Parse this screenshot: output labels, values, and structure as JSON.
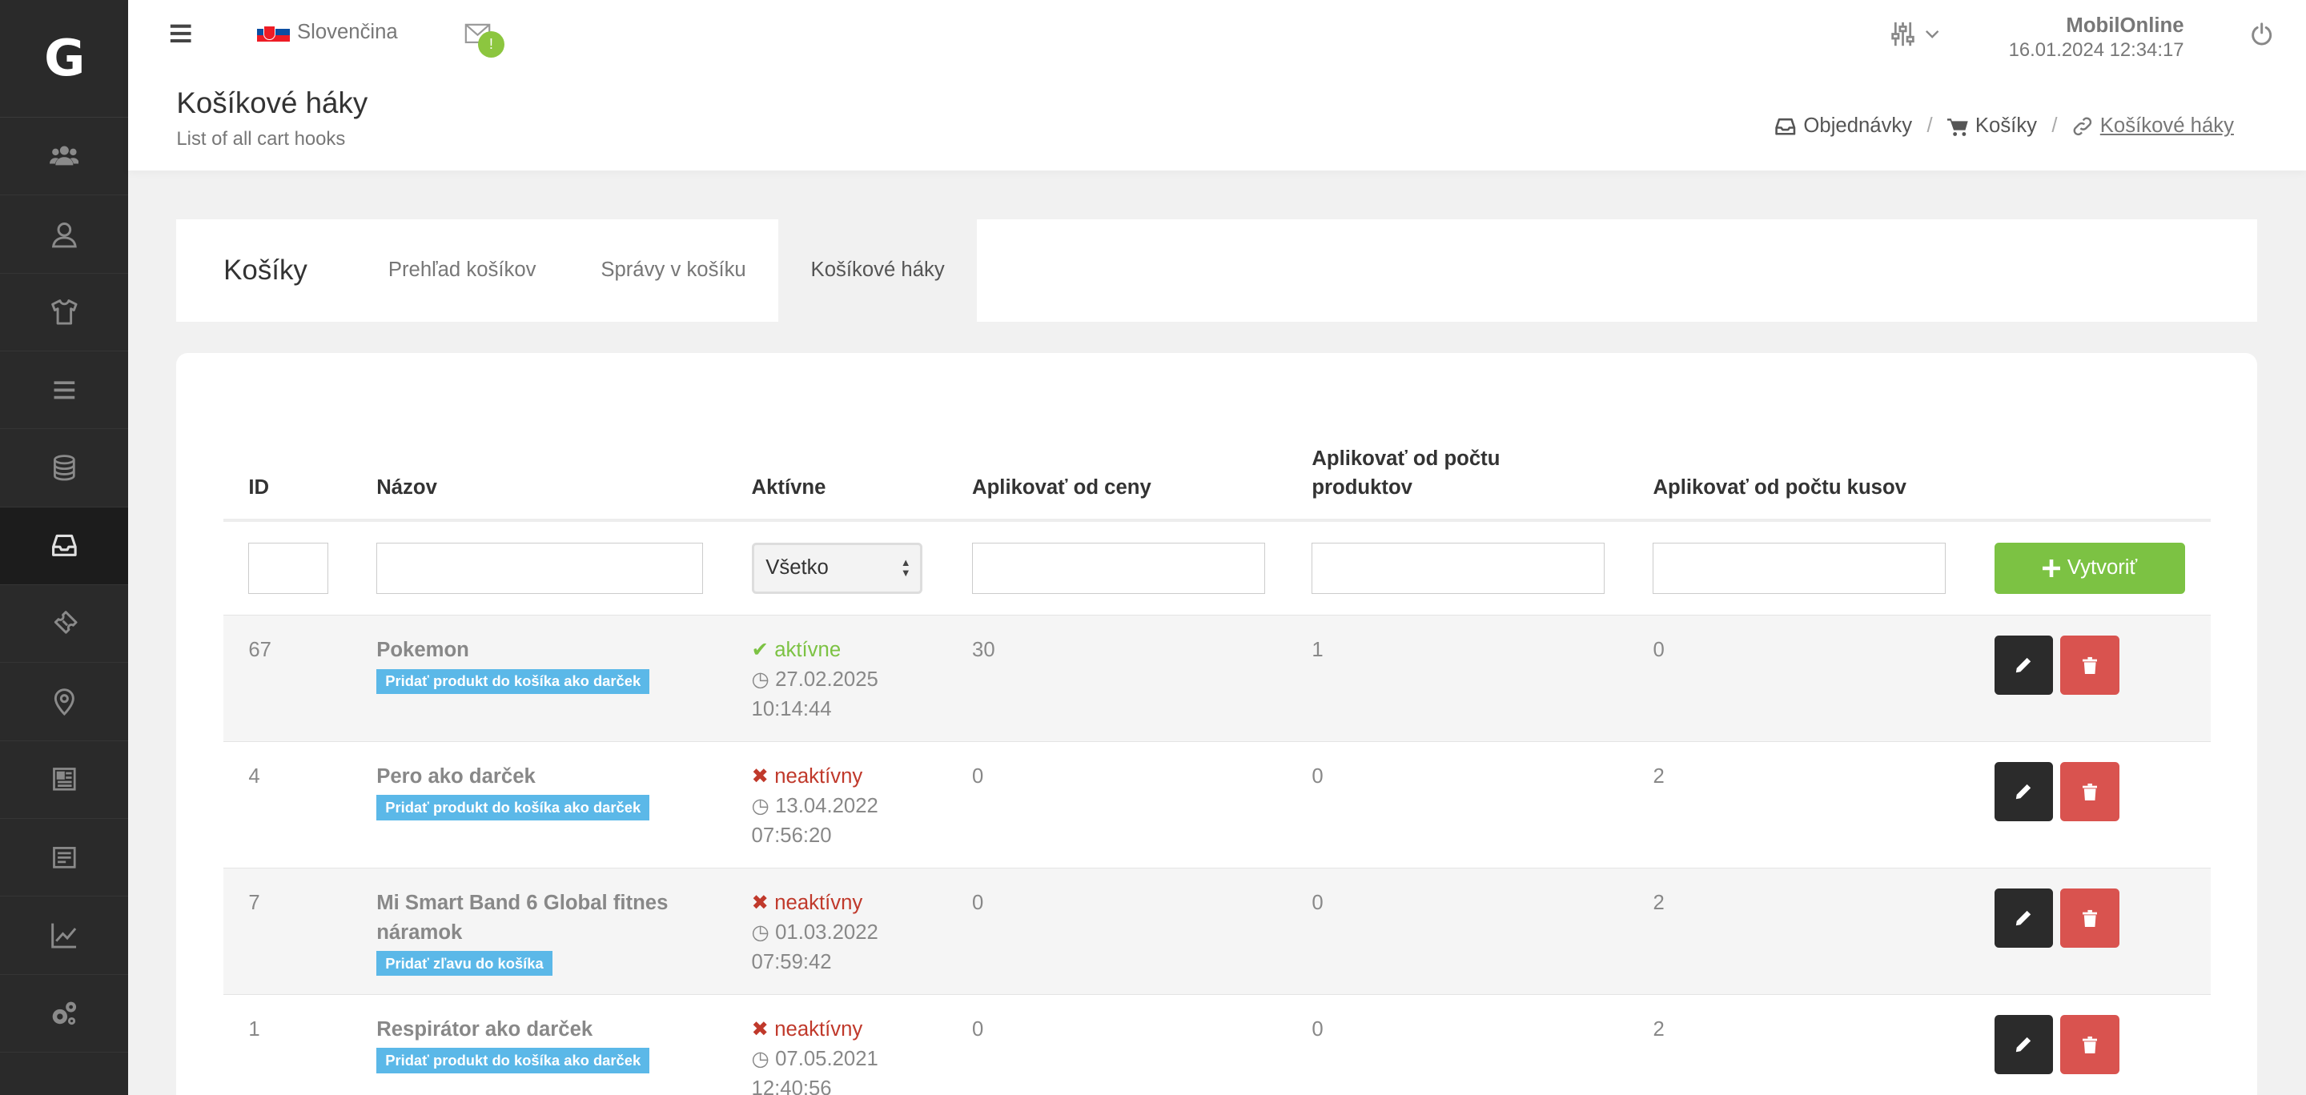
{
  "sidebar": {
    "logo": "G",
    "items": [
      {
        "icon": "users-icon"
      },
      {
        "icon": "user-icon"
      },
      {
        "icon": "tshirt-icon"
      },
      {
        "icon": "list-icon"
      },
      {
        "icon": "database-icon"
      },
      {
        "icon": "inbox-icon",
        "active": true
      },
      {
        "icon": "ticket-icon"
      },
      {
        "icon": "map-marker-icon"
      },
      {
        "icon": "newspaper-icon"
      },
      {
        "icon": "document-icon"
      },
      {
        "icon": "chart-icon"
      },
      {
        "icon": "cogs-icon"
      }
    ]
  },
  "header": {
    "language": "Slovenčina",
    "mail_badge": "!",
    "user_name": "MobilOnline",
    "datetime": "16.01.2024 12:34:17",
    "page_title": "Košíkové háky",
    "page_subtitle": "List of all cart hooks",
    "breadcrumb": [
      "Objednávky",
      "Košíky",
      "Košíkové háky"
    ]
  },
  "tabs": {
    "title": "Košíky",
    "items": [
      "Prehľad košíkov",
      "Správy v košíku",
      "Košíkové háky"
    ],
    "active_index": 2
  },
  "table": {
    "columns": [
      "ID",
      "Názov",
      "Aktívne",
      "Aplikovať od ceny",
      "Aplikovať od počtu produktov",
      "Aplikovať od počtu kusov"
    ],
    "filter_select_value": "Všetko",
    "create_label": "Vytvoriť",
    "rows": [
      {
        "id": "67",
        "name": "Pokemon",
        "tag": "Pridať produkt do košíka ako darček",
        "status": "aktívne",
        "active": true,
        "date": "27.02.2025",
        "time": "10:14:44",
        "price": "30",
        "products": "1",
        "pieces": "0"
      },
      {
        "id": "4",
        "name": "Pero ako darček",
        "tag": "Pridať produkt do košíka ako darček",
        "status": "neaktívny",
        "active": false,
        "date": "13.04.2022",
        "time": "07:56:20",
        "price": "0",
        "products": "0",
        "pieces": "2"
      },
      {
        "id": "7",
        "name": "Mi Smart Band 6 Global fitnes náramok",
        "tag": "Pridať zľavu do košíka",
        "status": "neaktívny",
        "active": false,
        "date": "01.03.2022",
        "time": "07:59:42",
        "price": "0",
        "products": "0",
        "pieces": "2"
      },
      {
        "id": "1",
        "name": "Respirátor ako darček",
        "tag": "Pridať produkt do košíka ako darček",
        "status": "neaktívny",
        "active": false,
        "date": "07.05.2021",
        "time": "12:40:56",
        "price": "0",
        "products": "0",
        "pieces": "2"
      }
    ]
  },
  "colors": {
    "sidebar_bg": "#2a2a2a",
    "accent_green": "#7cc243",
    "danger_red": "#d9534f",
    "tag_blue": "#5bb8e8",
    "status_active": "#7cc243",
    "status_inactive": "#c0392b"
  }
}
